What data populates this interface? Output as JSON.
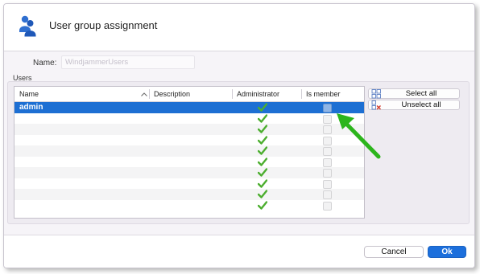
{
  "dialog": {
    "title": "User group assignment",
    "icon": "users-icon"
  },
  "form": {
    "name_label": "Name:",
    "name_value": "WindjammerUsers",
    "users_label": "Users"
  },
  "table": {
    "columns": [
      "Name",
      "Description",
      "Administrator",
      "Is member"
    ],
    "sort_column": "Name",
    "rows": [
      {
        "name": "admin",
        "description": "",
        "administrator": true,
        "is_member": false,
        "selected": true
      },
      {
        "name": "",
        "description": "",
        "administrator": true,
        "is_member": false,
        "selected": false
      },
      {
        "name": "",
        "description": "",
        "administrator": true,
        "is_member": false,
        "selected": false
      },
      {
        "name": "",
        "description": "",
        "administrator": true,
        "is_member": false,
        "selected": false
      },
      {
        "name": "",
        "description": "",
        "administrator": true,
        "is_member": false,
        "selected": false
      },
      {
        "name": "",
        "description": "",
        "administrator": true,
        "is_member": false,
        "selected": false
      },
      {
        "name": "",
        "description": "",
        "administrator": true,
        "is_member": false,
        "selected": false
      },
      {
        "name": "",
        "description": "",
        "administrator": true,
        "is_member": false,
        "selected": false
      },
      {
        "name": "",
        "description": "",
        "administrator": true,
        "is_member": false,
        "selected": false
      },
      {
        "name": "",
        "description": "",
        "administrator": true,
        "is_member": false,
        "selected": false
      }
    ]
  },
  "actions": {
    "select_all": "Select all",
    "unselect_all": "Unselect all",
    "cancel": "Cancel",
    "ok": "Ok"
  },
  "colors": {
    "accent": "#1d6fd3",
    "check": "#4cae2f",
    "annotation_arrow": "#2cb51c"
  }
}
